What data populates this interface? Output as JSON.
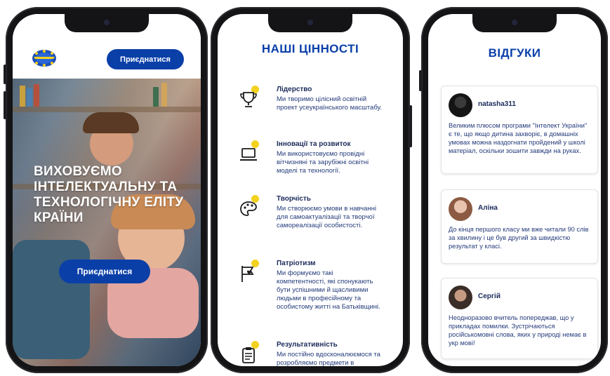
{
  "screens": {
    "home": {
      "header": {
        "join_label": "Приєднатися"
      },
      "hero": {
        "title": "ВИХОВУЄМО ІНТЕЛЕКТУАЛЬНУ ТА ТЕХНОЛОГІЧНУ ЕЛІТУ КРАЇНИ",
        "join_label": "Приєднатися"
      }
    },
    "values": {
      "title": "НАШІ ЦІННОСТІ",
      "items": [
        {
          "title": "Лідерство",
          "text": "Ми творимо цілісний освітній проект усеукраїнського масштабу.",
          "icon": "trophy-icon"
        },
        {
          "title": "Інновації та розвиток",
          "text": "Ми використовуємо провідні вітчизняні та зарубіжні освітні моделі та технології.",
          "icon": "laptop-icon"
        },
        {
          "title": "Творчість",
          "text": "Ми створюємо умови в навчанні для самоактуалізації та творчої самореалізації особистості.",
          "icon": "palette-icon"
        },
        {
          "title": "Патріотизм",
          "text": "Ми формуємо такі компетентності, які спонукають бути успішними й щасливими людьми в професійному та особистому житті на Батьківщині.",
          "icon": "heart-flag-icon"
        },
        {
          "title": "Результативність",
          "text": "Ми постійно вдосконалюємося та розробляємо предмети в",
          "icon": "clipboard-icon"
        }
      ]
    },
    "reviews": {
      "title": "ВІДГУКИ",
      "items": [
        {
          "name": "natasha311",
          "text": "Великим плюсом програми \"Інтелект України\" є те, що якщо дитина захворіє, в домашніх умовах можна наздогнати пройдений у школі матеріал, оскільки зошити завжди на руках."
        },
        {
          "name": "Аліна",
          "text": "До кінця першого класу ми вже читали 90 слів за хвилину і це був другий за швидкістю результат у класі."
        },
        {
          "name": "Сергій",
          "text": "Неодноразово вчитель попереджав, що у прикладах помилки. Зустрічаються російськомовні слова, яких у природі немає в укр мові!"
        }
      ]
    }
  },
  "colors": {
    "brand_blue": "#0a3fa8",
    "accent_yellow": "#f2d21e",
    "text_navy": "#1b2a5a"
  }
}
